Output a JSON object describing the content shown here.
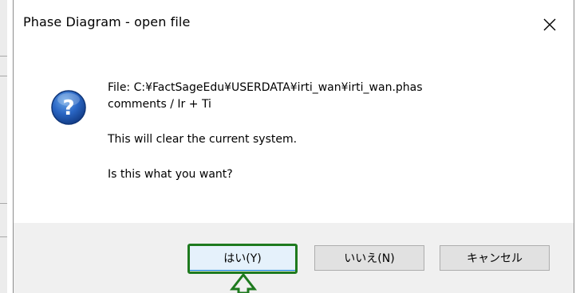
{
  "dialog": {
    "title": "Phase Diagram - open file",
    "close_glyph": "✕",
    "icon": "question-icon",
    "icon_glyph": "?",
    "message": {
      "file_line": "File: C:¥FactSageEdu¥USERDATA¥irti_wan¥irti_wan.phas",
      "comments_line": "comments / Ir  +  Ti",
      "warning_line": "This will clear the current system.",
      "question_line": "Is this what you want?"
    },
    "buttons": {
      "yes_label": "はい(Y)",
      "no_label": "いいえ(N)",
      "cancel_label": "キャンセル"
    }
  },
  "annotation": {
    "highlight_color": "#1e7a1e",
    "arrow": "up-arrow-icon"
  }
}
